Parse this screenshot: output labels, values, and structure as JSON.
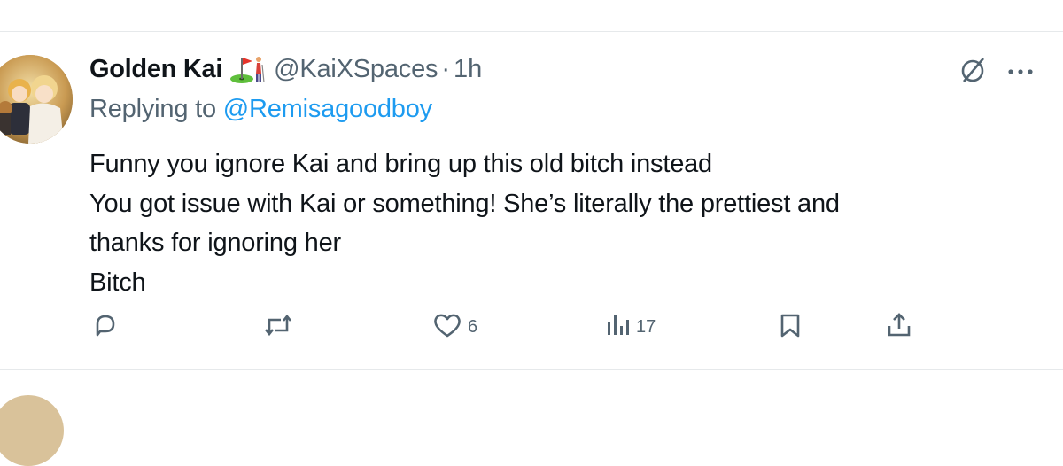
{
  "tweet": {
    "display_name": "Golden Kai",
    "name_emoji": "golf-emoji",
    "handle": "@KaiXSpaces",
    "separator": "·",
    "time": "1h",
    "replying_prefix": "Replying to ",
    "replying_to": "@Remisagoodboy",
    "text_lines": [
      "Funny you ignore Kai and bring up this old bitch instead",
      "You got issue with Kai or something! She’s literally the prettiest and",
      "thanks for ignoring her",
      "Bitch"
    ],
    "actions": {
      "reply_icon": "reply-icon",
      "retweet_icon": "retweet-icon",
      "like_icon": "heart-icon",
      "like_count": "6",
      "views_icon": "views-icon",
      "views_count": "17",
      "bookmark_icon": "bookmark-icon",
      "share_icon": "share-icon"
    },
    "top_icons": [
      "grok-icon",
      "more-icon"
    ]
  },
  "colors": {
    "text": "#0f1419",
    "secondary": "#536471",
    "link": "#1d9bf0",
    "divider": "#e6e9eb"
  }
}
